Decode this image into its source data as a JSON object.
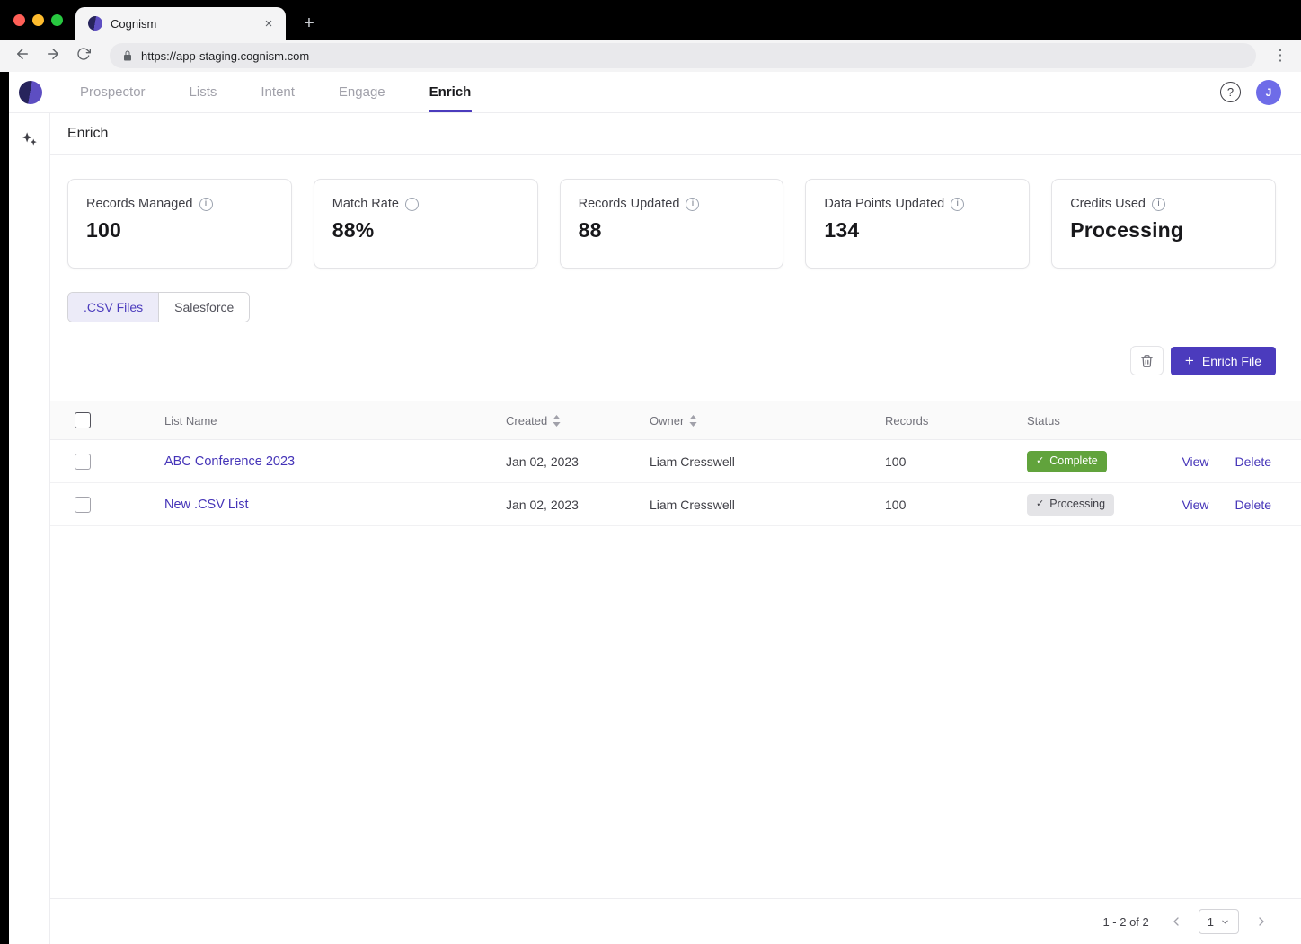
{
  "browser": {
    "tab_title": "Cognism",
    "url": "https://app-staging.cognism.com"
  },
  "header": {
    "nav": [
      {
        "label": "Prospector"
      },
      {
        "label": "Lists"
      },
      {
        "label": "Intent"
      },
      {
        "label": "Engage"
      },
      {
        "label": "Enrich"
      }
    ],
    "avatar_initial": "J",
    "help_glyph": "?"
  },
  "page": {
    "title": "Enrich"
  },
  "stats": [
    {
      "label": "Records Managed",
      "value": "100"
    },
    {
      "label": "Match Rate",
      "value": "88%"
    },
    {
      "label": "Records Updated",
      "value": "88"
    },
    {
      "label": "Data Points Updated",
      "value": "134"
    },
    {
      "label": "Credits Used",
      "value": "Processing"
    }
  ],
  "source_tabs": [
    {
      "label": ".CSV Files"
    },
    {
      "label": "Salesforce"
    }
  ],
  "toolbar": {
    "enrich_file_label": "Enrich File"
  },
  "table": {
    "headers": {
      "name": "List Name",
      "created": "Created",
      "owner": "Owner",
      "records": "Records",
      "status": "Status"
    },
    "rows": [
      {
        "name": "ABC Conference 2023",
        "created": "Jan 02, 2023",
        "owner": "Liam Cresswell",
        "records": "100",
        "status": "Complete",
        "view_label": "View",
        "delete_label": "Delete"
      },
      {
        "name": "New .CSV List",
        "created": "Jan 02, 2023",
        "owner": "Liam Cresswell",
        "records": "100",
        "status": "Processing",
        "view_label": "View",
        "delete_label": "Delete"
      }
    ]
  },
  "pagination": {
    "range_text": "1 - 2 of 2",
    "current_page": "1"
  },
  "colors": {
    "brand_purple": "#4B3BBD",
    "link_purple": "#4534B8",
    "complete_green": "#61A33C",
    "processing_gray": "#E4E4E7"
  }
}
